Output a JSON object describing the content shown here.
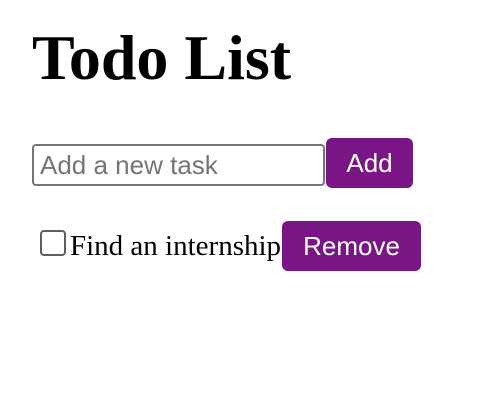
{
  "header": {
    "title": "Todo List"
  },
  "add_form": {
    "input_value": "",
    "input_placeholder": "Add a new task",
    "add_label": "Add"
  },
  "todos": [
    {
      "text": "Find an internship",
      "completed": false,
      "remove_label": "Remove"
    }
  ],
  "colors": {
    "button_background": "#7a1585",
    "button_text": "#ffffff"
  }
}
